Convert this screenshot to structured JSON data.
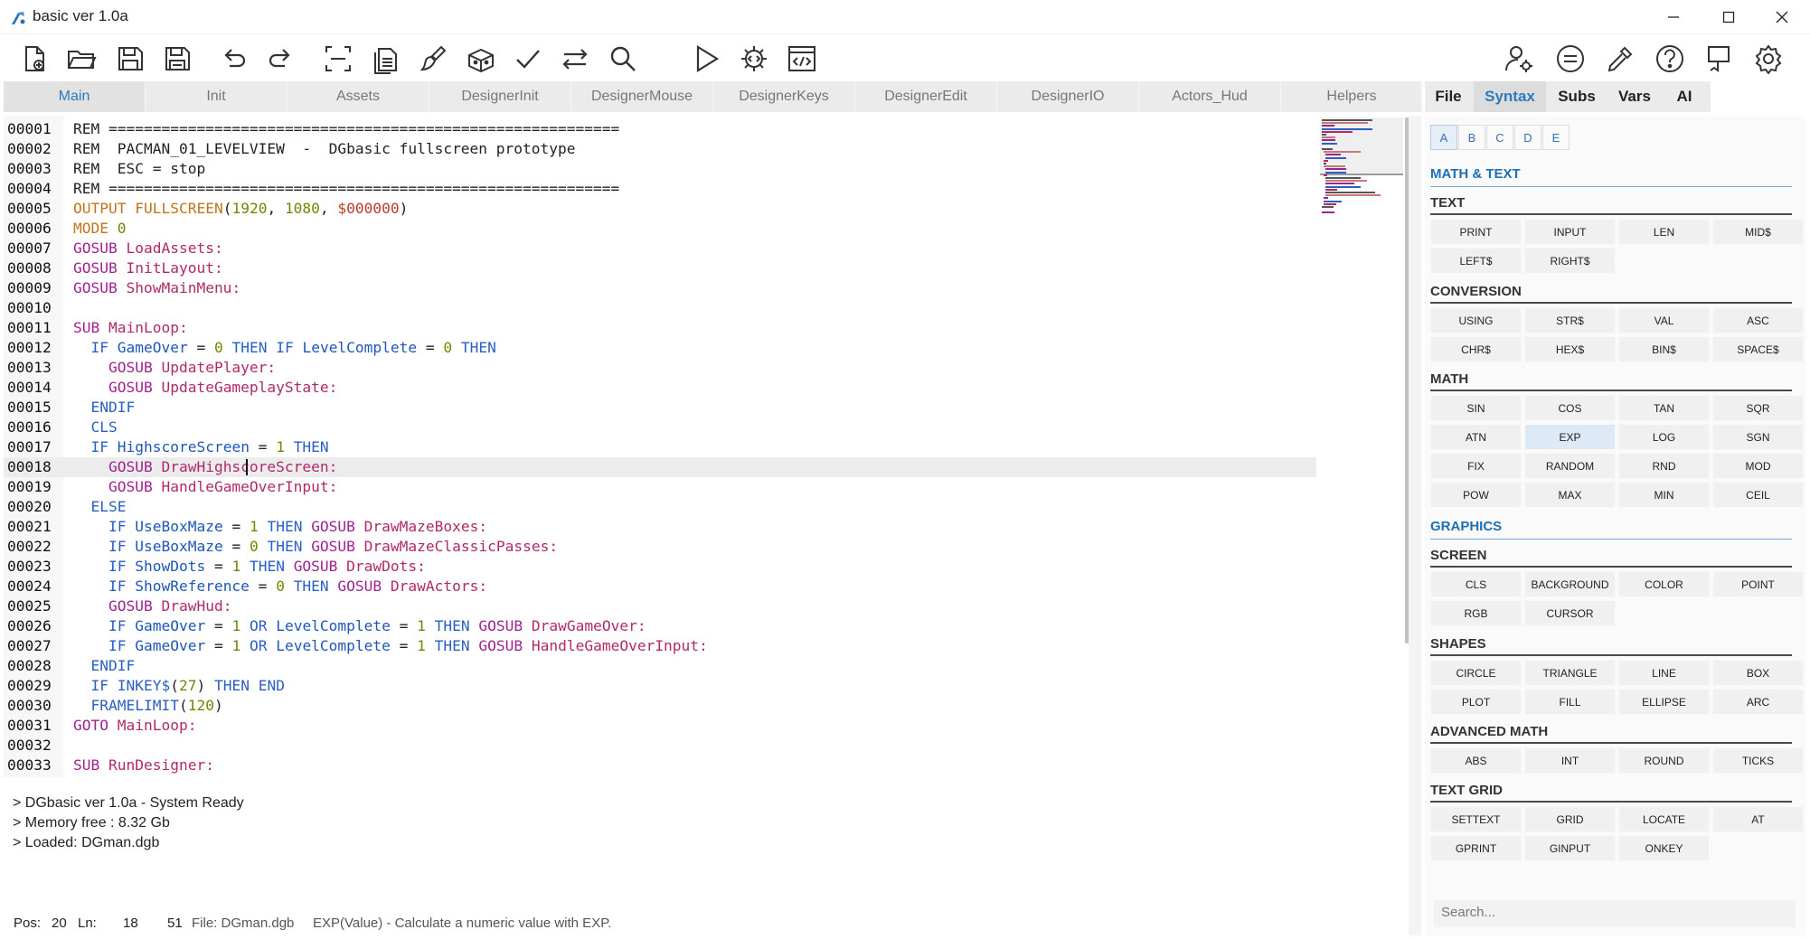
{
  "window": {
    "title": "basic ver 1.0a",
    "controls": [
      "minimize",
      "maximize",
      "close"
    ]
  },
  "toolbar": {
    "left": [
      "new-file",
      "open-folder",
      "save",
      "save-as",
      "undo",
      "redo",
      "select-all",
      "copy",
      "brush",
      "package",
      "check",
      "swap",
      "search"
    ],
    "middle": [
      "run",
      "compile",
      "code-view"
    ],
    "right": [
      "user-settings",
      "equals",
      "eyedropper",
      "help",
      "flag",
      "settings"
    ]
  },
  "tabs": [
    "Main",
    "Init",
    "Assets",
    "DesignerInit",
    "DesignerMouse",
    "DesignerKeys",
    "DesignerEdit",
    "DesignerIO",
    "Actors_Hud",
    "Helpers"
  ],
  "active_tab": "Main",
  "right_tabs": [
    "File",
    "Syntax",
    "Subs",
    "Vars",
    "AI"
  ],
  "active_right_tab": "Syntax",
  "letters": [
    "A",
    "B",
    "C",
    "D",
    "E"
  ],
  "active_letter": "A",
  "code_lines": [
    {
      "n": "00001",
      "t": "REM =========================================================="
    },
    {
      "n": "00002",
      "t": "REM  PACMAN_01_LEVELVIEW  -  DGbasic fullscreen prototype"
    },
    {
      "n": "00003",
      "t": "REM  ESC = stop"
    },
    {
      "n": "00004",
      "t": "REM =========================================================="
    },
    {
      "n": "00005",
      "t": "OUTPUT FULLSCREEN(1920, 1080, $000000)"
    },
    {
      "n": "00006",
      "t": "MODE 0"
    },
    {
      "n": "00007",
      "t": "GOSUB LoadAssets:"
    },
    {
      "n": "00008",
      "t": "GOSUB InitLayout:"
    },
    {
      "n": "00009",
      "t": "GOSUB ShowMainMenu:"
    },
    {
      "n": "00010",
      "t": ""
    },
    {
      "n": "00011",
      "t": "SUB MainLoop:"
    },
    {
      "n": "00012",
      "t": "  IF GameOver = 0 THEN IF LevelComplete = 0 THEN"
    },
    {
      "n": "00013",
      "t": "    GOSUB UpdatePlayer:"
    },
    {
      "n": "00014",
      "t": "    GOSUB UpdateGameplayState:"
    },
    {
      "n": "00015",
      "t": "  ENDIF"
    },
    {
      "n": "00016",
      "t": "  CLS"
    },
    {
      "n": "00017",
      "t": "  IF HighscoreScreen = 1 THEN"
    },
    {
      "n": "00018",
      "t": "    GOSUB DrawHighscoreScreen:"
    },
    {
      "n": "00019",
      "t": "    GOSUB HandleGameOverInput:"
    },
    {
      "n": "00020",
      "t": "  ELSE"
    },
    {
      "n": "00021",
      "t": "    IF UseBoxMaze = 1 THEN GOSUB DrawMazeBoxes:"
    },
    {
      "n": "00022",
      "t": "    IF UseBoxMaze = 0 THEN GOSUB DrawMazeClassicPasses:"
    },
    {
      "n": "00023",
      "t": "    IF ShowDots = 1 THEN GOSUB DrawDots:"
    },
    {
      "n": "00024",
      "t": "    IF ShowReference = 0 THEN GOSUB DrawActors:"
    },
    {
      "n": "00025",
      "t": "    GOSUB DrawHud:"
    },
    {
      "n": "00026",
      "t": "    IF GameOver = 1 OR LevelComplete = 1 THEN GOSUB DrawGameOver:"
    },
    {
      "n": "00027",
      "t": "    IF GameOver = 1 OR LevelComplete = 1 THEN GOSUB HandleGameOverInput:"
    },
    {
      "n": "00028",
      "t": "  ENDIF"
    },
    {
      "n": "00029",
      "t": "  IF INKEY$(27) THEN END"
    },
    {
      "n": "00030",
      "t": "  FRAMELIMIT(120)"
    },
    {
      "n": "00031",
      "t": "GOTO MainLoop:"
    },
    {
      "n": "00032",
      "t": ""
    },
    {
      "n": "00033",
      "t": "SUB RunDesigner:"
    }
  ],
  "current_line": "00018",
  "console": [
    "> DGbasic ver 1.0a - System Ready",
    "> Memory free : 8.32 Gb",
    "> Loaded: DGman.dgb"
  ],
  "status": {
    "pos_label": "Pos:",
    "pos": "20",
    "ln_label": "Ln:",
    "ln": "18",
    "total": "51",
    "file": "File: DGman.dgb",
    "hint": "EXP(Value) - Calculate a numeric value with EXP."
  },
  "syntax_panel": {
    "math_text_heading": "MATH & TEXT",
    "text_heading": "TEXT",
    "text_items": [
      "PRINT",
      "INPUT",
      "LEN",
      "MID$",
      "LEFT$",
      "RIGHT$"
    ],
    "conversion_heading": "CONVERSION",
    "conversion_items": [
      "USING",
      "STR$",
      "VAL",
      "ASC",
      "CHR$",
      "HEX$",
      "BIN$",
      "SPACE$"
    ],
    "math_heading": "MATH",
    "math_items": [
      "SIN",
      "COS",
      "TAN",
      "SQR",
      "ATN",
      "EXP",
      "LOG",
      "SGN",
      "FIX",
      "RANDOM",
      "RND",
      "MOD",
      "POW",
      "MAX",
      "MIN",
      "CEIL"
    ],
    "highlighted": "EXP",
    "graphics_heading": "GRAPHICS",
    "screen_heading": "SCREEN",
    "screen_items": [
      "CLS",
      "BACKGROUND",
      "COLOR",
      "POINT",
      "RGB",
      "CURSOR"
    ],
    "shapes_heading": "SHAPES",
    "shapes_items": [
      "CIRCLE",
      "TRIANGLE",
      "LINE",
      "BOX",
      "PLOT",
      "FILL",
      "ELLIPSE",
      "ARC"
    ],
    "adv_math_heading": "ADVANCED MATH",
    "adv_math_items": [
      "ABS",
      "INT",
      "ROUND",
      "TICKS"
    ],
    "text_grid_heading": "TEXT GRID",
    "text_grid_items": [
      "SETTEXT",
      "GRID",
      "LOCATE",
      "AT",
      "GPRINT",
      "GINPUT",
      "ONKEY"
    ],
    "search_placeholder": "Search..."
  },
  "colors": {
    "accent": "#2a7bbf",
    "keyword_gosub": "#a0228f",
    "keyword_if": "#2a5fc4",
    "sub_name": "#b02a68",
    "number": "#6b8a00"
  }
}
